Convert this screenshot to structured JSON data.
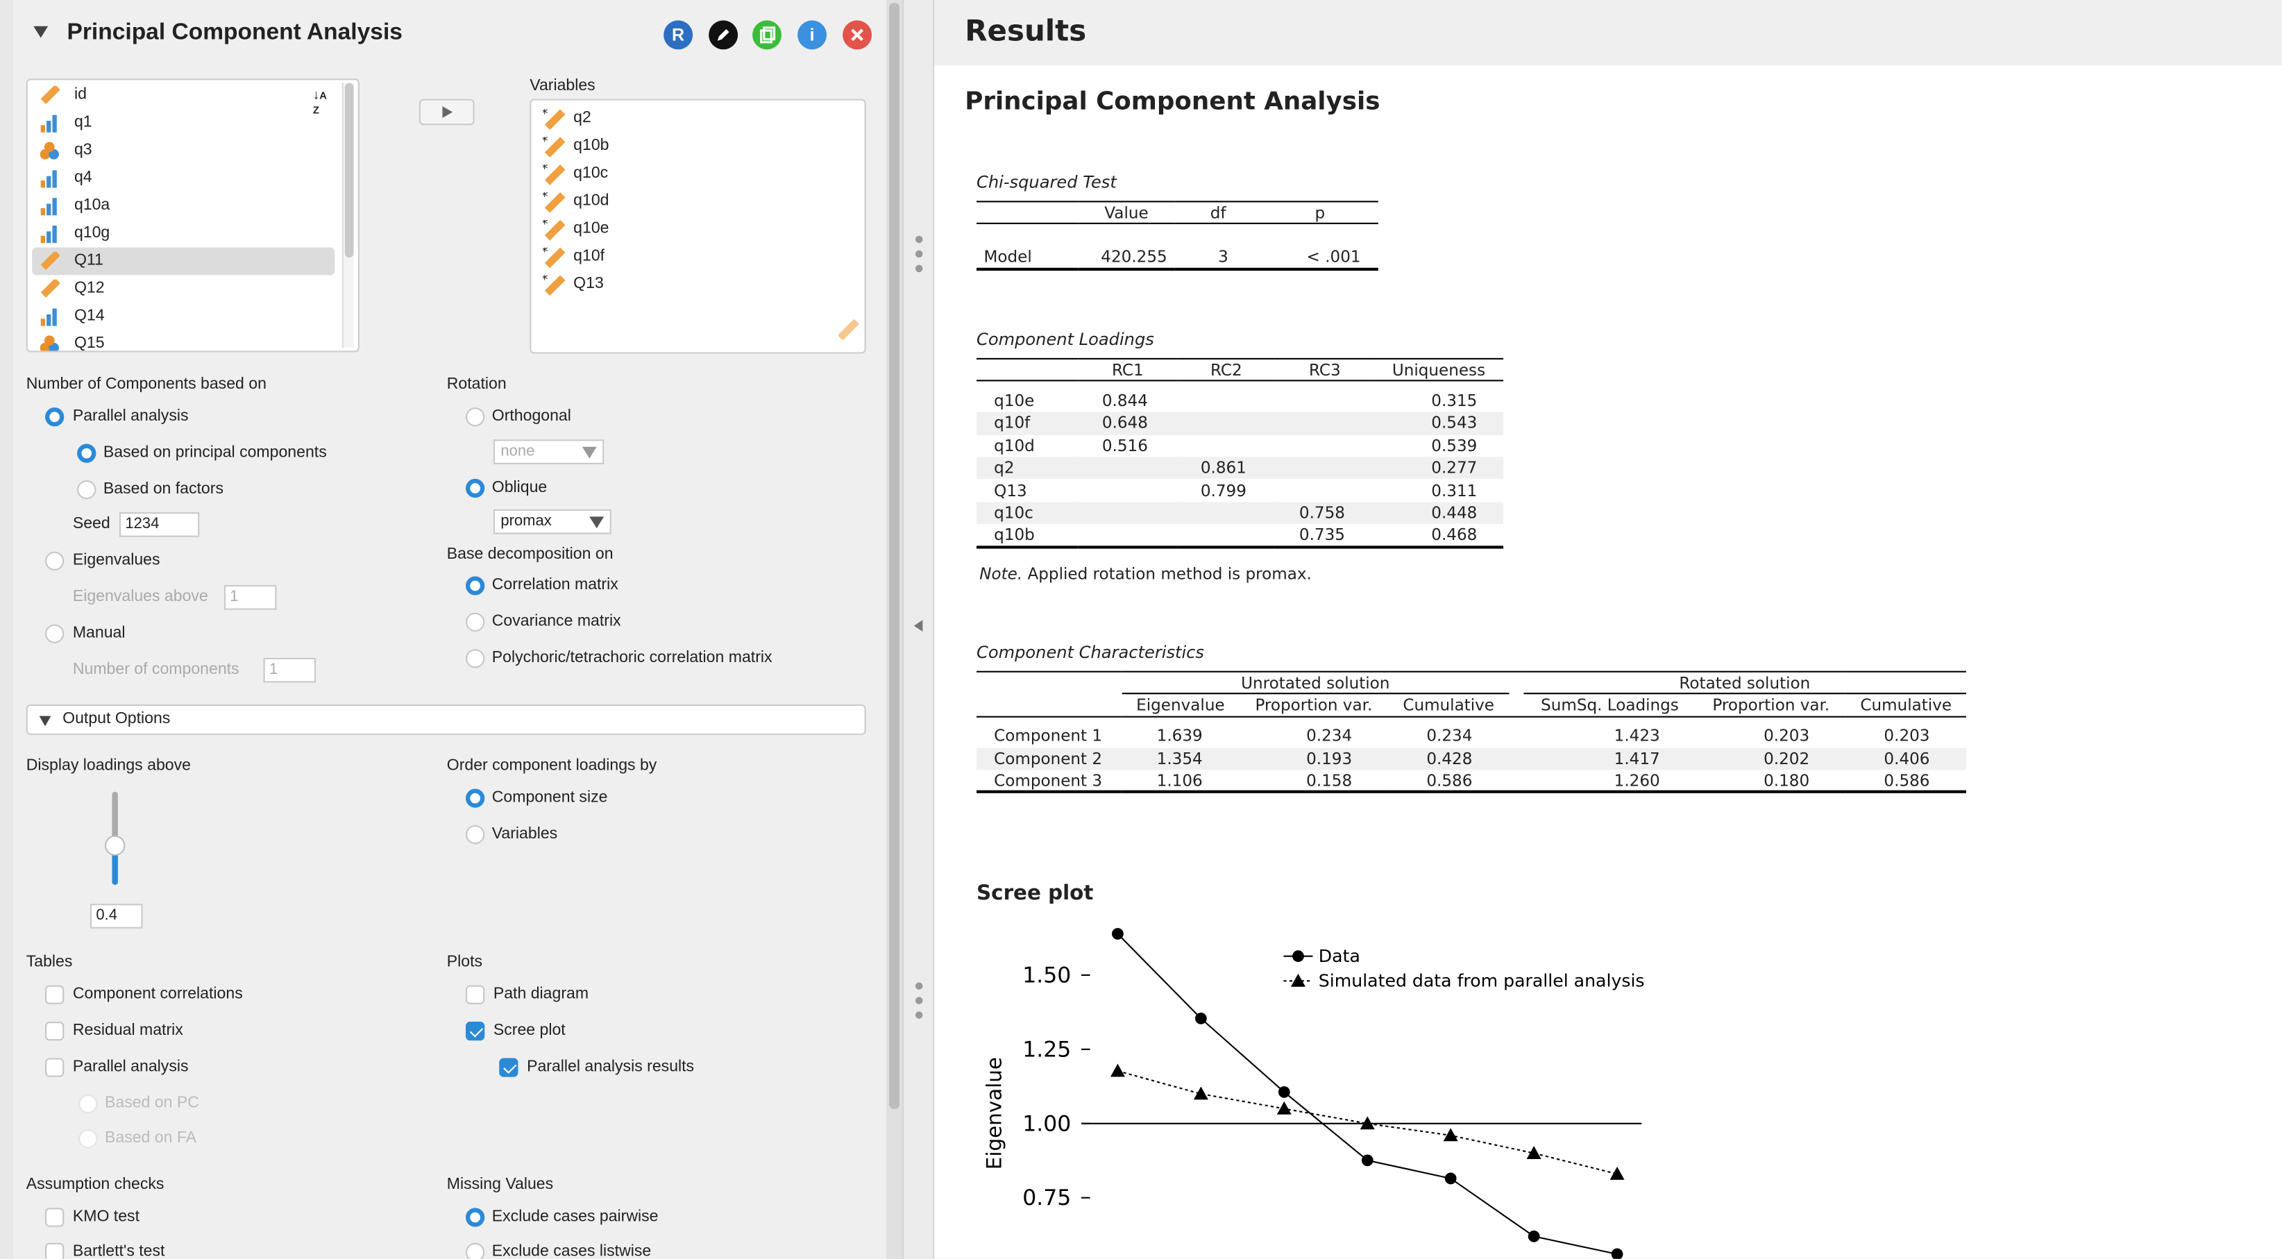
{
  "header": {
    "title": "Principal Component Analysis"
  },
  "icons": {
    "r": "R",
    "info": "i"
  },
  "available": {
    "items": [
      {
        "label": "id",
        "icon": "ruler-icon"
      },
      {
        "label": "q1",
        "icon": "bar-chart-icon"
      },
      {
        "label": "q3",
        "icon": "nominal-icon"
      },
      {
        "label": "q4",
        "icon": "bar-chart-icon"
      },
      {
        "label": "q10a",
        "icon": "bar-chart-icon"
      },
      {
        "label": "q10g",
        "icon": "bar-chart-icon"
      },
      {
        "label": "Q11",
        "icon": "ruler-icon",
        "selected": true
      },
      {
        "label": "Q12",
        "icon": "ruler-icon"
      },
      {
        "label": "Q14",
        "icon": "bar-chart-icon"
      },
      {
        "label": "Q15",
        "icon": "nominal-icon"
      }
    ]
  },
  "variables": {
    "title": "Variables",
    "items": [
      "q2",
      "q10b",
      "q10c",
      "q10d",
      "q10e",
      "q10f",
      "Q13"
    ]
  },
  "components": {
    "title": "Number of Components based on",
    "parallel": "Parallel analysis",
    "based_pc": "Based on principal components",
    "based_factors": "Based on factors",
    "seed_label": "Seed",
    "seed_value": "1234",
    "eigenvalues": "Eigenvalues",
    "eigen_above": "Eigenvalues above",
    "eigen_value": "1",
    "manual": "Manual",
    "num_components": "Number of components",
    "num_value": "1"
  },
  "rotation": {
    "title": "Rotation",
    "orthogonal": "Orthogonal",
    "orth_select": "none",
    "oblique": "Oblique",
    "obl_select": "promax",
    "base_title": "Base decomposition on",
    "correlation": "Correlation matrix",
    "covariance": "Covariance matrix",
    "polychoric": "Polychoric/tetrachoric correlation matrix"
  },
  "output": {
    "header": "Output Options",
    "display_loadings": "Display loadings above",
    "loadings_value": "0.4",
    "order_title": "Order component loadings by",
    "comp_size": "Component size",
    "vars": "Variables",
    "tables_title": "Tables",
    "comp_corr": "Component correlations",
    "residual": "Residual matrix",
    "parallel": "Parallel analysis",
    "based_pc": "Based on PC",
    "based_fa": "Based on FA",
    "plots_title": "Plots",
    "path": "Path diagram",
    "scree": "Scree plot",
    "par_results": "Parallel analysis results",
    "assump_title": "Assumption checks",
    "kmo": "KMO test",
    "bartlett": "Bartlett's test",
    "missing_title": "Missing Values",
    "pairwise": "Exclude cases pairwise",
    "listwise": "Exclude cases listwise"
  },
  "results": {
    "title": "Results",
    "analysis_title": "Principal Component Analysis",
    "chi": {
      "title": "Chi-squared Test",
      "headers": [
        "",
        "Value",
        "df",
        "p"
      ],
      "row": [
        "Model",
        "420.255",
        "3",
        "< .001"
      ]
    },
    "loadings": {
      "title": "Component Loadings",
      "headers": [
        "",
        "RC1",
        "RC2",
        "RC3",
        "Uniqueness"
      ],
      "rows": [
        [
          "q10e",
          "0.844",
          "",
          "",
          "0.315"
        ],
        [
          "q10f",
          "0.648",
          "",
          "",
          "0.543"
        ],
        [
          "q10d",
          "0.516",
          "",
          "",
          "0.539"
        ],
        [
          "q2",
          "",
          "0.861",
          "",
          "0.277"
        ],
        [
          "Q13",
          "",
          "0.799",
          "",
          "0.311"
        ],
        [
          "q10c",
          "",
          "",
          "0.758",
          "0.448"
        ],
        [
          "q10b",
          "",
          "",
          "0.735",
          "0.468"
        ]
      ],
      "note_label": "Note.",
      "note_text": " Applied rotation method is promax."
    },
    "characteristics": {
      "title": "Component Characteristics",
      "group1": "Unrotated solution",
      "group2": "Rotated solution",
      "headers": [
        "",
        "Eigenvalue",
        "Proportion var.",
        "Cumulative",
        "SumSq. Loadings",
        "Proportion var.",
        "Cumulative"
      ],
      "rows": [
        [
          "Component 1",
          "1.639",
          "0.234",
          "0.234",
          "1.423",
          "0.203",
          "0.203"
        ],
        [
          "Component 2",
          "1.354",
          "0.193",
          "0.428",
          "1.417",
          "0.202",
          "0.406"
        ],
        [
          "Component 3",
          "1.106",
          "0.158",
          "0.586",
          "1.260",
          "0.180",
          "0.586"
        ]
      ]
    },
    "scree_title": "Scree plot"
  },
  "chart_data": {
    "type": "line",
    "ylabel": "Eigenvalue",
    "yticks": [
      "1.50",
      "1.25",
      "1.00",
      "0.75"
    ],
    "reference_line": 1.0,
    "x": [
      1,
      2,
      3,
      4,
      5,
      6,
      7
    ],
    "series": [
      {
        "name": "Data",
        "marker": "circle",
        "line": "solid",
        "values": [
          1.639,
          1.354,
          1.106,
          0.876,
          0.815,
          0.62,
          0.56
        ]
      },
      {
        "name": "Simulated data from parallel analysis",
        "marker": "triangle",
        "line": "dotted",
        "values": [
          1.177,
          1.1,
          1.05,
          1.0,
          0.96,
          0.9,
          0.83
        ]
      }
    ],
    "ylim": [
      0.7,
      1.7
    ],
    "legend": "top-right"
  }
}
